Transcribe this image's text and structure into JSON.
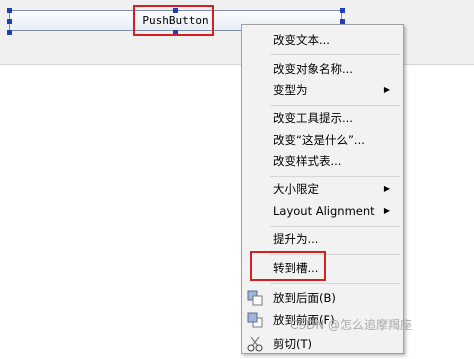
{
  "form": {
    "push_button_label": "PushButton"
  },
  "context_menu": {
    "items": [
      {
        "label": "改变文本...",
        "submenu": false
      },
      {
        "label": "改变对象名称...",
        "submenu": false
      },
      {
        "label": "变型为",
        "submenu": true
      },
      {
        "label": "改变工具提示...",
        "submenu": false
      },
      {
        "label": "改变“这是什么”...",
        "submenu": false
      },
      {
        "label": "改变样式表...",
        "submenu": false
      },
      {
        "label": "大小限定",
        "submenu": true
      },
      {
        "label": "Layout Alignment",
        "submenu": true
      },
      {
        "label": "提升为...",
        "submenu": false
      },
      {
        "label": "转到槽...",
        "submenu": false
      },
      {
        "label": "放到后面(B)",
        "submenu": false,
        "icon": "send-to-back-icon"
      },
      {
        "label": "放到前面(F)",
        "submenu": false,
        "icon": "bring-to-front-icon"
      },
      {
        "label": "剪切(T)",
        "submenu": false,
        "icon": "cut-icon"
      }
    ],
    "submenu_arrow": "▶"
  },
  "watermark": "CSDN @怎么追摩羯座",
  "colors": {
    "highlight": "#d42020",
    "selection_handle": "#1f3fb8",
    "menu_background": "#f2f2f2"
  }
}
